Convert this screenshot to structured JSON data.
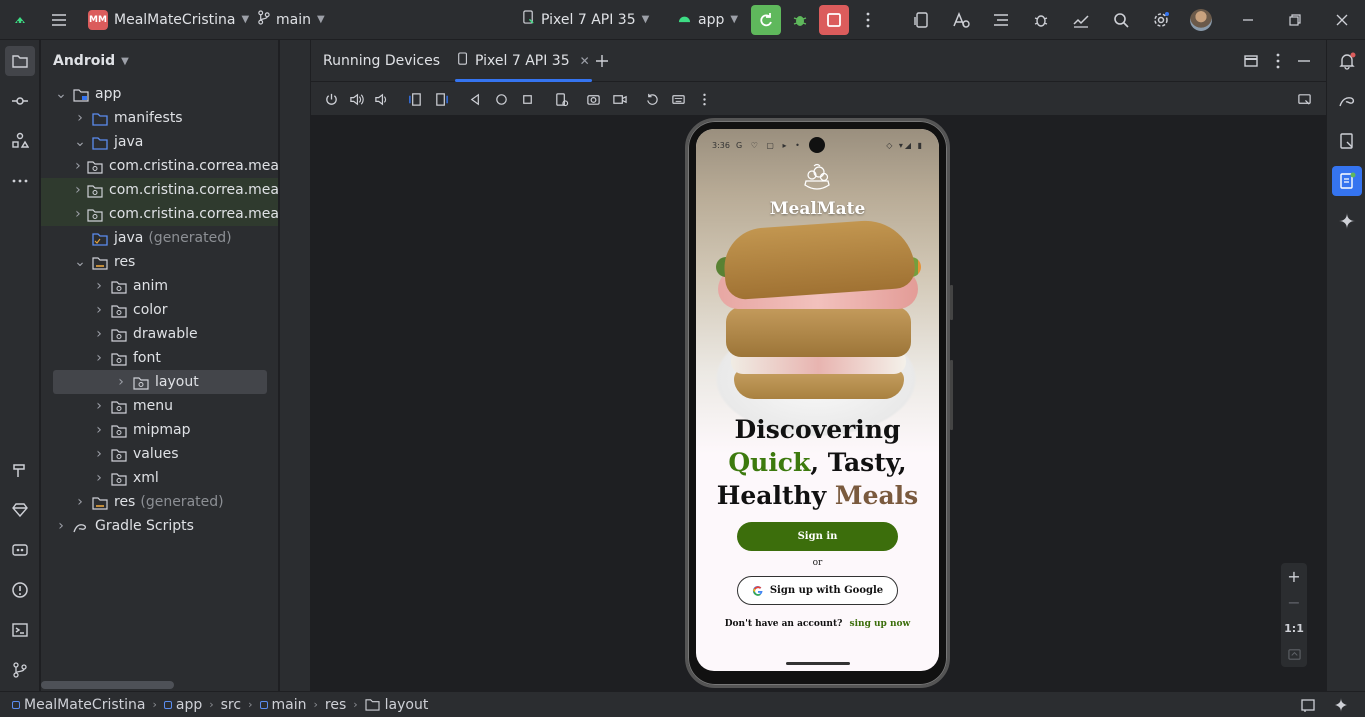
{
  "titlebar": {
    "project_initials": "MM",
    "project_name": "MealMateCristina",
    "branch": "main",
    "device": "Pixel 7 API 35",
    "run_config": "app"
  },
  "project_panel": {
    "view": "Android",
    "tree": [
      {
        "label": "app",
        "suffix": ""
      },
      {
        "label": "manifests",
        "suffix": ""
      },
      {
        "label": "java",
        "suffix": ""
      },
      {
        "label": "com.cristina.correa.mea",
        "suffix": ""
      },
      {
        "label": "com.cristina.correa.mea",
        "suffix": ""
      },
      {
        "label": "com.cristina.correa.mea",
        "suffix": ""
      },
      {
        "label": "java",
        "suffix": "(generated)"
      },
      {
        "label": "res",
        "suffix": ""
      },
      {
        "label": "anim",
        "suffix": ""
      },
      {
        "label": "color",
        "suffix": ""
      },
      {
        "label": "drawable",
        "suffix": ""
      },
      {
        "label": "font",
        "suffix": ""
      },
      {
        "label": "layout",
        "suffix": ""
      },
      {
        "label": "menu",
        "suffix": ""
      },
      {
        "label": "mipmap",
        "suffix": ""
      },
      {
        "label": "values",
        "suffix": ""
      },
      {
        "label": "xml",
        "suffix": ""
      },
      {
        "label": "res",
        "suffix": "(generated)"
      },
      {
        "label": "Gradle Scripts",
        "suffix": ""
      }
    ]
  },
  "running_devices": {
    "title": "Running Devices",
    "tab": "Pixel 7 API 35"
  },
  "phone": {
    "status_time": "3:36",
    "brand": "MealMate",
    "headline_1": "Discovering",
    "headline_2a": "Quick",
    "headline_2b": ", Tasty,",
    "headline_3a": "Healthy ",
    "headline_3b": "Meals",
    "sign_in": "Sign in",
    "or": "or",
    "google": "Sign up with Google",
    "no_account": "Don't have an account?",
    "sign_up_now": "sing up now"
  },
  "zoom": {
    "plus": "+",
    "minus": "−",
    "one_to_one": "1:1"
  },
  "statusbar": {
    "crumbs": [
      "MealMateCristina",
      "app",
      "src",
      "main",
      "res",
      "layout"
    ]
  },
  "colors": {
    "accent": "#3574f0",
    "brand_green": "#3c6e0c",
    "project_badge": "#db5c5c"
  }
}
